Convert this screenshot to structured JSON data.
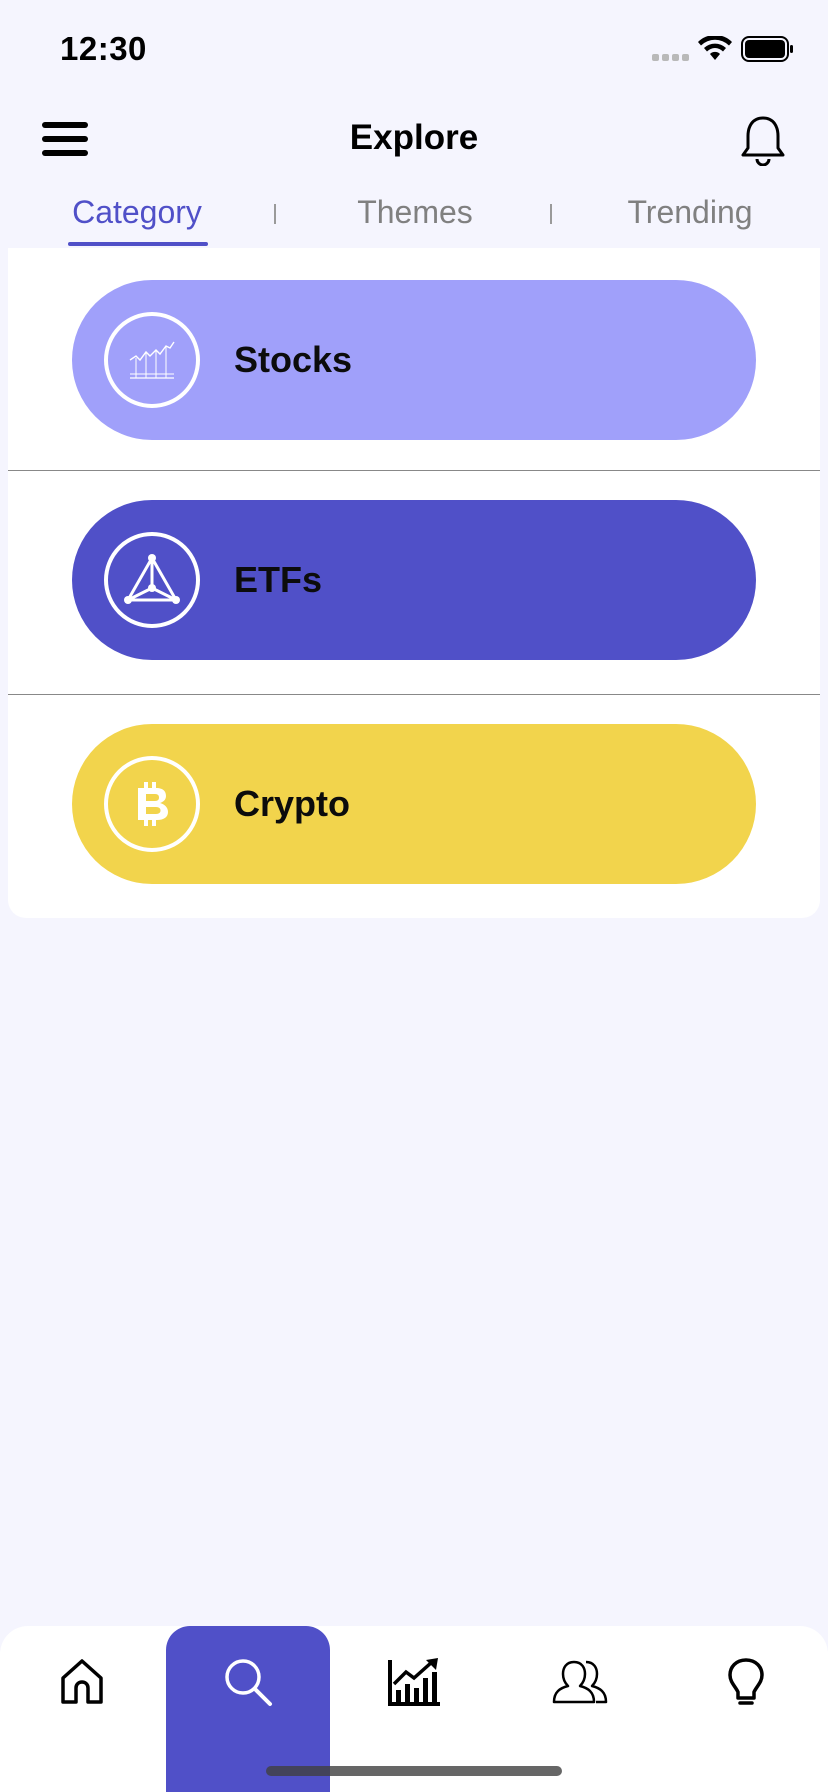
{
  "status_bar": {
    "time": "12:30"
  },
  "header": {
    "title": "Explore"
  },
  "tabs": [
    {
      "label": "Category",
      "active": true
    },
    {
      "label": "Themes",
      "active": false
    },
    {
      "label": "Trending",
      "active": false
    }
  ],
  "categories": [
    {
      "label": "Stocks",
      "color": "#a0a0fa",
      "icon": "stock-chart-icon"
    },
    {
      "label": "ETFs",
      "color": "#5050c8",
      "icon": "pyramid-icon"
    },
    {
      "label": "Crypto",
      "color": "#f2d44c",
      "icon": "bitcoin-icon"
    }
  ],
  "bottom_nav": [
    {
      "name": "home",
      "icon": "home-icon",
      "active": false
    },
    {
      "name": "explore",
      "icon": "search-icon",
      "active": true
    },
    {
      "name": "markets",
      "icon": "growth-chart-icon",
      "active": false
    },
    {
      "name": "social",
      "icon": "users-icon",
      "active": false
    },
    {
      "name": "ideas",
      "icon": "lightbulb-icon",
      "active": false
    }
  ],
  "colors": {
    "accent": "#5050c8",
    "background": "#f5f5fe"
  }
}
